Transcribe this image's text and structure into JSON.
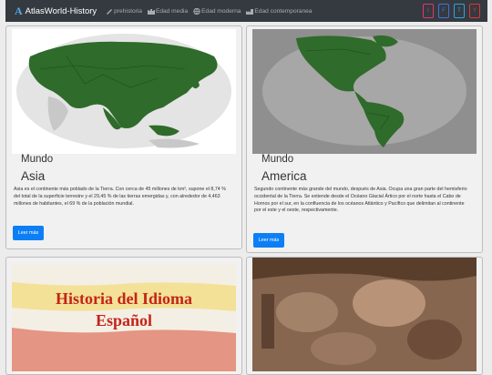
{
  "brand": {
    "logo": "A",
    "title": "AtlasWorld-History"
  },
  "nav": [
    {
      "label": "prehistoria",
      "icon": "tools-icon"
    },
    {
      "label": "Edad media",
      "icon": "castle-icon"
    },
    {
      "label": "Edad moderna",
      "icon": "globe-icon"
    },
    {
      "label": "Edad contemporanea",
      "icon": "factory-icon"
    }
  ],
  "social": [
    {
      "label": "I",
      "name": "instagram-link",
      "color": "#e0366d"
    },
    {
      "label": "F",
      "name": "facebook-link",
      "color": "#4a6fd6"
    },
    {
      "label": "T",
      "name": "twitter-link",
      "color": "#2aa5e0"
    },
    {
      "label": "Y",
      "name": "youtube-link",
      "color": "#e03636"
    }
  ],
  "cards": [
    {
      "subtitle": "Mundo",
      "title": "Asia",
      "description": "Asia es el continente más poblado de la Tierra. Con cerca de 45 millones de km², supone el 8,74 % del total de la superficie terrestre y el 29,45 % de las tierras emergidas y, con alrededor de 4,463 millones de habitantes, el 69 % de la población mundial.",
      "button": "Leer más",
      "image": "asia-map"
    },
    {
      "subtitle": "Mundo",
      "title": "America",
      "description": "Segundo continente más grande del mundo, después de Asia. Ocupa una gran parte del hemisferio occidental de la Tierra. Se extiende desde el Océano Glacial Ártico por el norte hasta el Cabo de Hornos por el sur, en la confluencia de los océanos Atlántico y Pacífico que delimitan al continente por el este y el oeste, respectivamente.",
      "button": "Leer más",
      "image": "america-map"
    }
  ],
  "lower_cards": [
    {
      "image_text_line1": "Historia del Idioma",
      "image_text_line2": "Español",
      "image": "idioma-banner"
    },
    {
      "image": "fresco-painting"
    }
  ]
}
